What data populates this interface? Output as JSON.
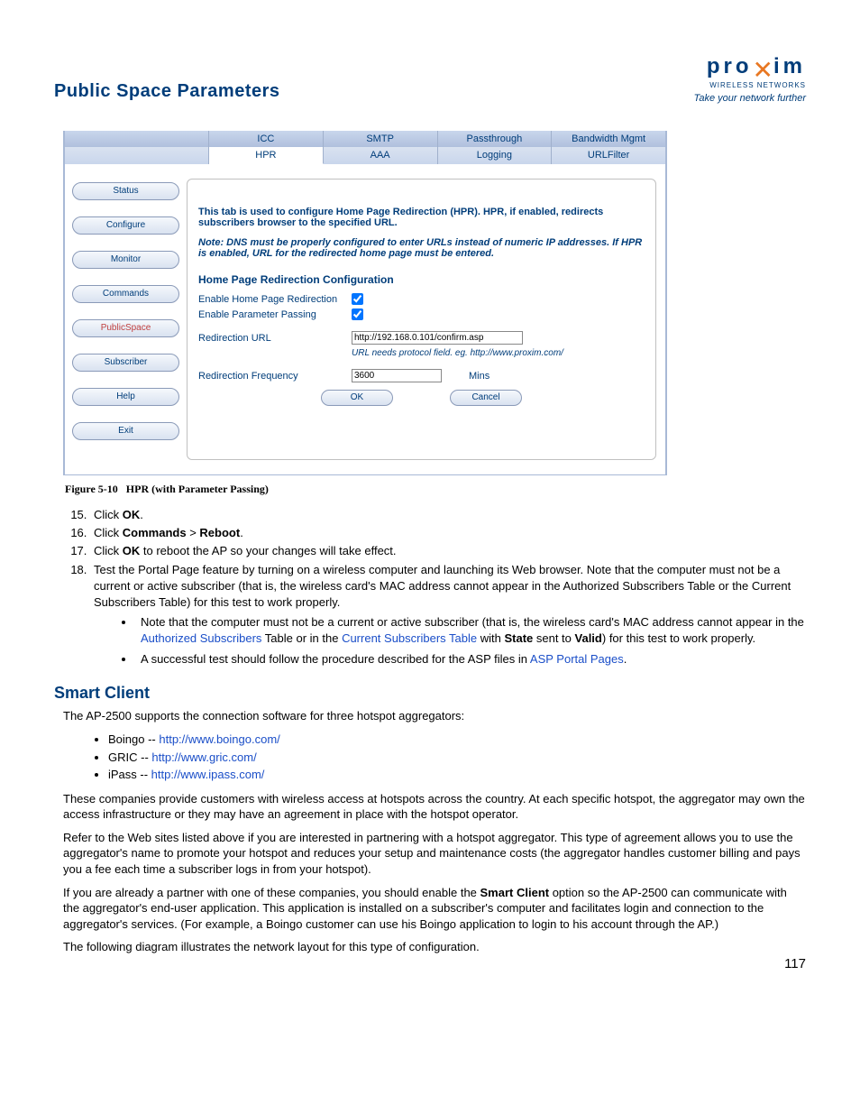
{
  "header": {
    "page_title": "Public Space Parameters",
    "logo": {
      "brand": "pro",
      "x": "x",
      "brand2": "im",
      "sub": "WIRELESS NETWORKS",
      "tag": "Take your network further"
    }
  },
  "screenshot": {
    "tabs_row1": [
      "ICC",
      "SMTP",
      "Passthrough",
      "Bandwidth Mgmt"
    ],
    "tabs_row2": [
      "HPR",
      "AAA",
      "Logging",
      "URLFilter"
    ],
    "active_tab": "HPR",
    "sidebar": [
      "Status",
      "Configure",
      "Monitor",
      "Commands",
      "PublicSpace",
      "Subscriber",
      "Help",
      "Exit"
    ],
    "sidebar_active": "PublicSpace",
    "panel": {
      "intro": "This tab is used to configure Home Page Redirection (HPR). HPR, if enabled, redirects subscribers browser to the specified URL.",
      "note": "Note: DNS must be properly configured to enter URLs instead of numeric IP addresses. If HPR is enabled, URL for the redirected home page must be entered.",
      "heading": "Home Page Redirection Configuration",
      "rows": {
        "enable_hpr": {
          "label": "Enable Home Page Redirection",
          "checked": true
        },
        "enable_pp": {
          "label": "Enable Parameter Passing",
          "checked": true
        },
        "redir_url": {
          "label": "Redirection URL",
          "value": "http://192.168.0.101/confirm.asp"
        },
        "url_hint": "URL needs protocol field. eg. http://www.proxim.com/",
        "redir_freq": {
          "label": "Redirection Frequency",
          "value": "3600",
          "unit": "Mins"
        }
      },
      "ok": "OK",
      "cancel": "Cancel"
    }
  },
  "figure_caption": {
    "num": "Figure 5-10",
    "title": "HPR (with Parameter Passing)"
  },
  "steps": {
    "s15": {
      "pre": "Click ",
      "b": "OK",
      "post": "."
    },
    "s16": {
      "pre": "Click ",
      "b1": "Commands",
      "mid": " > ",
      "b2": "Reboot",
      "post": "."
    },
    "s17": {
      "pre": "Click ",
      "b": "OK",
      "post": " to reboot the AP so your changes will take effect."
    },
    "s18": "Test the Portal Page feature by turning on a wireless computer and launching its Web browser. Note that the computer must not be a current or active subscriber (that is, the wireless card's MAC address cannot appear in the Authorized Subscribers Table or the Current Subscribers Table) for this test to work properly.",
    "s18a_pre": "Note that the computer must not be a current or active subscriber (that is, the wireless card's MAC address cannot appear in the ",
    "s18a_link1": "Authorized Subscribers",
    "s18a_mid": " Table or in the ",
    "s18a_link2": "Current Subscribers Table",
    "s18a_mid2": " with ",
    "s18a_b": "State",
    "s18a_mid3": " sent to ",
    "s18a_b2": "Valid",
    "s18a_post": ") for this test to work properly.",
    "s18b_pre": "A successful test should follow the procedure described for the ASP files in ",
    "s18b_link": "ASP Portal Pages",
    "s18b_post": "."
  },
  "smart_client": {
    "heading": "Smart Client",
    "p1": "The AP-2500 supports the connection software for three hotspot aggregators:",
    "aggs": [
      {
        "name": "Boingo -- ",
        "url": "http://www.boingo.com/"
      },
      {
        "name": "GRIC -- ",
        "url": "http://www.gric.com/"
      },
      {
        "name": "iPass -- ",
        "url": "http://www.ipass.com/"
      }
    ],
    "p2": "These companies provide customers with wireless access at hotspots across the country. At each specific hotspot, the aggregator may own the access infrastructure or they may have an agreement in place with the hotspot operator.",
    "p3": "Refer to the Web sites listed above if you are interested in partnering with a hotspot aggregator. This type of agreement allows you to use the aggregator's name to promote your hotspot and reduces your setup and maintenance costs (the aggregator handles customer billing and pays you a fee each time a subscriber logs in from your hotspot).",
    "p4_pre": "If you are already a partner with one of these companies, you should enable the ",
    "p4_b": "Smart Client",
    "p4_post": " option so the AP-2500 can communicate with the aggregator's end-user application. This application is installed on a subscriber's computer and facilitates login and connection to the aggregator's services. (For example, a Boingo customer can use his Boingo application to login to his account through the AP.)",
    "p5": "The following diagram illustrates the network layout for this type of configuration."
  },
  "page_number": "117"
}
